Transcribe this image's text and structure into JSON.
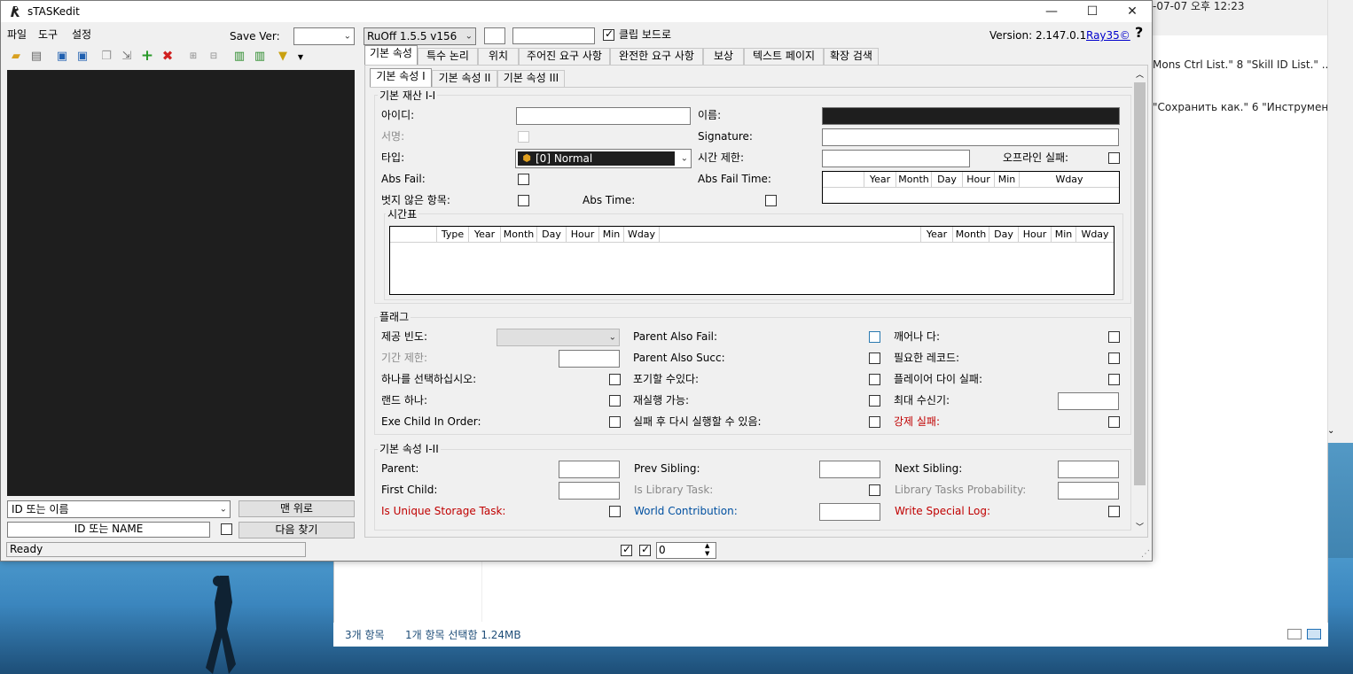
{
  "explorer": {
    "timestamp": "-07-07 오후 12:23",
    "row1": "Mons Ctrl List.\" 8 \"Skill ID List.\" ...",
    "row2": "\"Сохранить как.\" 6 \"Инструмен...",
    "status_items": "3개 항목",
    "status_selected": "1개 항목 선택함 1.24MB"
  },
  "window": {
    "title": "sTASKedit",
    "minimize": "—",
    "maximize": "☐",
    "close": "✕"
  },
  "menu": [
    "파일",
    "도구",
    "설정"
  ],
  "toolbar": {
    "save_ver_label": "Save Ver:",
    "save_ver_value": "",
    "version_combo": "RuOff 1.5.5 v156",
    "small_field": "",
    "wide_field": "",
    "clipboard_label": "클립 보드로",
    "version_text": "Version: 2.147.0.1",
    "author_link": "Ray35©",
    "help": "?"
  },
  "left": {
    "search_combo": "ID 또는 이름",
    "top_button": "맨 위로",
    "search_input": "ID 또는 NAME",
    "next_button": "다음 찾기",
    "status": "Ready"
  },
  "tabs": [
    "기본 속성",
    "특수 논리",
    "위치",
    "주어진 요구 사항",
    "완전한 요구 사항",
    "보상",
    "텍스트 페이지",
    "확장 검색"
  ],
  "subtabs": [
    "기본 속성 I",
    "기본 속성 II",
    "기본 속성 III"
  ],
  "basic": {
    "group_title": "기본 재산 I-I",
    "id_label": "아이디:",
    "name_label": "이름:",
    "sign_label": "서명:",
    "signature_label": "Signature:",
    "type_label": "타입:",
    "type_value": "[0] Normal",
    "time_limit_label": "시간 제한:",
    "offline_fail_label": "오프라인 실패:",
    "abs_fail_label": "Abs Fail:",
    "abs_fail_time_label": "Abs Fail Time:",
    "unclear_label": "벗지 않은 항목:",
    "abs_time_label": "Abs Time:",
    "abs_table_headers": [
      "",
      "Year",
      "Month",
      "Day",
      "Hour",
      "Min",
      "Wday"
    ],
    "schedule_title": "시간표",
    "schedule_headers_left": [
      "",
      "Type",
      "Year",
      "Month",
      "Day",
      "Hour",
      "Min",
      "Wday"
    ],
    "schedule_headers_right": [
      "Year",
      "Month",
      "Day",
      "Hour",
      "Min",
      "Wday"
    ]
  },
  "flags": {
    "title": "플래그",
    "col1": [
      {
        "label": "제공 빈도:",
        "style": "normal"
      },
      {
        "label": "기간 제한:",
        "style": "gray"
      },
      {
        "label": "하나를 선택하십시오:",
        "style": "normal"
      },
      {
        "label": "랜드 하나:",
        "style": "normal"
      },
      {
        "label": "Exe Child In Order:",
        "style": "normal"
      }
    ],
    "col2": [
      {
        "label": "Parent Also Fail:",
        "style": "normal"
      },
      {
        "label": "Parent Also Succ:",
        "style": "normal"
      },
      {
        "label": "포기할 수있다:",
        "style": "normal"
      },
      {
        "label": "재실행 가능:",
        "style": "normal"
      },
      {
        "label": "실패 후 다시 실행할 수 있음:",
        "style": "normal"
      }
    ],
    "col3": [
      {
        "label": "깨어나 다:",
        "style": "normal"
      },
      {
        "label": "필요한 레코드:",
        "style": "normal"
      },
      {
        "label": "플레이어 다이 실패:",
        "style": "normal"
      },
      {
        "label": "최대 수신기:",
        "style": "normal"
      },
      {
        "label": "강제 실패:",
        "style": "red"
      }
    ]
  },
  "basic2": {
    "title": "기본 속성 I-II",
    "col1": [
      {
        "label": "Parent:",
        "style": "normal"
      },
      {
        "label": "First Child:",
        "style": "normal"
      },
      {
        "label": "Is Unique Storage Task:",
        "style": "red"
      }
    ],
    "col2": [
      {
        "label": "Prev Sibling:",
        "style": "normal"
      },
      {
        "label": "Is Library Task:",
        "style": "gray"
      },
      {
        "label": "World Contribution:",
        "style": "blue"
      }
    ],
    "col3": [
      {
        "label": "Next Sibling:",
        "style": "normal"
      },
      {
        "label": "Library Tasks Probability:",
        "style": "gray"
      },
      {
        "label": "Write Special Log:",
        "style": "red"
      }
    ]
  },
  "bottom": {
    "spin_value": "0"
  },
  "colors": {
    "dark_panel": "#1e1e1e",
    "window_bg": "#f0f0f0",
    "link": "#0000cc",
    "red_label": "#c00000"
  }
}
